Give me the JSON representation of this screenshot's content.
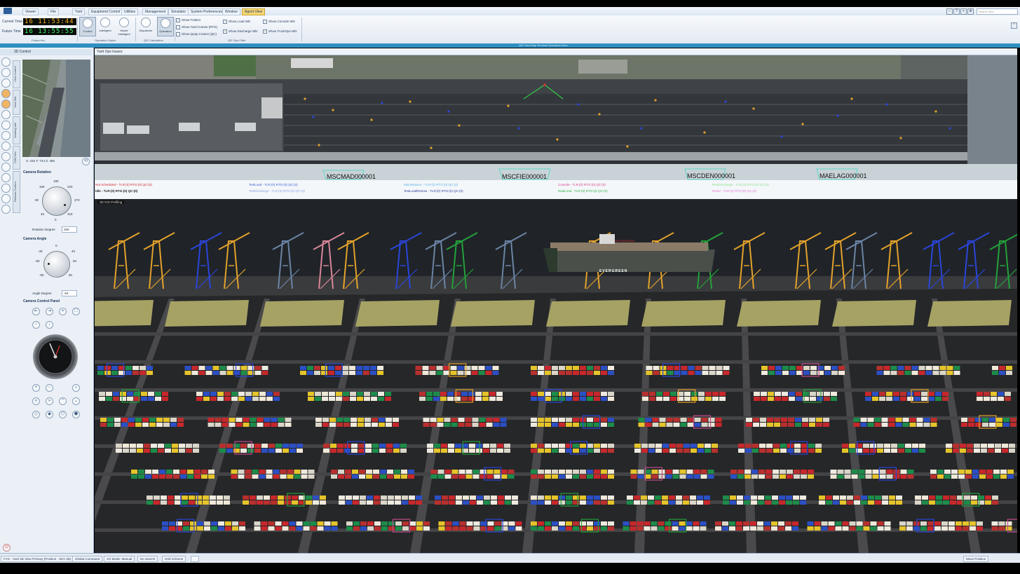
{
  "menu": {
    "items": [
      "Viewer",
      "File",
      "Yard",
      "Equipment Control",
      "Utilities",
      "Management",
      "Simulator",
      "System Preferences",
      "Window",
      "Agent View"
    ],
    "active_index": 9,
    "search_placeholder": "Search here"
  },
  "clocks": {
    "current_label": "Current Time",
    "current_value": "16 11:53:44",
    "future_label": "Future Time",
    "future_value": "16 13:55:55",
    "group_label": "Future Hrs"
  },
  "ribbon": {
    "buttons": [
      {
        "label": "Control",
        "selected": true
      },
      {
        "label": "Intelligent",
        "selected": false
      },
      {
        "label": "Model Intelligent",
        "selected": false
      },
      {
        "label": "Dispatcher",
        "selected": false
      },
      {
        "label": "Operation",
        "selected": true
      }
    ],
    "group_labels": [
      "Operation Option",
      "Q/E Calculation",
      "Q/E Ops Filter"
    ],
    "checks": [
      {
        "label": "Show Trailers",
        "checked": true
      },
      {
        "label": "Show Yard Cranes (RTG)",
        "checked": false
      },
      {
        "label": "Show Quay Cranes (QC)",
        "checked": false
      },
      {
        "label": "Show Load Wls",
        "checked": true
      },
      {
        "label": "Show Discharge Wls",
        "checked": true
      },
      {
        "label": "Show Console Wls",
        "checked": true
      },
      {
        "label": "Show TruckOps Wls",
        "checked": true
      }
    ]
  },
  "window_title": "Q/E Yard Map Terminal Operation View",
  "left_panel": {
    "title": "3D Control",
    "vertical_tabs": [
      "View Control",
      "Yard Stat",
      "Working Info",
      "CMS Info",
      "Release Control"
    ],
    "coords": "X: 416  Y: 744  Z: 486",
    "rotation": {
      "title": "Camera Rotation",
      "ticks": [
        "180",
        "150",
        "220",
        "90",
        "270",
        "45",
        "315",
        "0"
      ],
      "value_label": "Rotation Degree",
      "value": "260"
    },
    "angle": {
      "title": "Camera Angle",
      "ticks": [
        "0",
        "-40",
        "40",
        "-60",
        "60",
        "-80",
        "80"
      ],
      "value_label": "Angle Degree",
      "value": "-54"
    },
    "control_panel_title": "Camera Control Panel"
  },
  "viewport": {
    "header": "Yard Ops Issues",
    "sim_label": "3D GIS Profiling",
    "ship_labels": [
      "MSCMAD000001",
      "MSCFIE000001",
      "MSCDEN000001",
      "MAELAG000001"
    ],
    "legend": [
      {
        "text": "Not Scheduled - TLR:(0) RTG:(0) QC:(0)",
        "color": "#d0262a"
      },
      {
        "text": "Idle - TLR:(0) RTG:(0) QC:(0)",
        "color": "#1a1a1a"
      },
      {
        "text": "TestLoad - TLR:(0) RTG:(0) QC:(0)",
        "color": "#3a5fd0"
      },
      {
        "text": "TestDischarge - TLR:(0) RTG:(0) QC:(0)",
        "color": "#8aa3e0"
      },
      {
        "text": "Maintenance - TLR:(0) RTG:(0) QC:(0)",
        "color": "#5fb3e6"
      },
      {
        "text": "TestLoadRestow - TLR:(0) RTG:(0) QC:(0)",
        "color": "#2a3f9a"
      },
      {
        "text": "Console - TLR:(0) RTG:(0) QC:(0)",
        "color": "#d9408c"
      },
      {
        "text": "RealLoad - TLR:(0) RTG:(0) QC:(0)",
        "color": "#35b24a"
      },
      {
        "text": "RealDischarge - TLR:(0) RTG:(0) QC:(0)",
        "color": "#8ee08a"
      },
      {
        "text": "Reset - TLR:(0) RTG:(0) QC:(0)",
        "color": "#e07ad0"
      }
    ],
    "ship_name": "EVERGREEN",
    "ship_tag": "MSCFIE000001"
  },
  "status_bar": [
    "FVS - Yard 3D View Primary (Position - WCI 3D)",
    "Global Command",
    "XO Mode: Manual",
    "No Search",
    "Grid Scheme",
    "",
    "Move Position"
  ],
  "colors": {
    "accent": "#2f8fc0",
    "crane_yellow": "#e3a22b",
    "crane_blue": "#2a45d8",
    "crane_green": "#23a13a",
    "crane_pink": "#d9869a",
    "crane_steel": "#6b84a6",
    "grass": "#a6a264",
    "water": "#1d2024"
  },
  "icons": [
    "home-icon",
    "zoom-in-icon",
    "zoom-out-icon",
    "rotate-left-icon",
    "rotate-right-icon",
    "pan-up-icon",
    "pan-down-icon",
    "reset-view-icon",
    "power-icon"
  ]
}
